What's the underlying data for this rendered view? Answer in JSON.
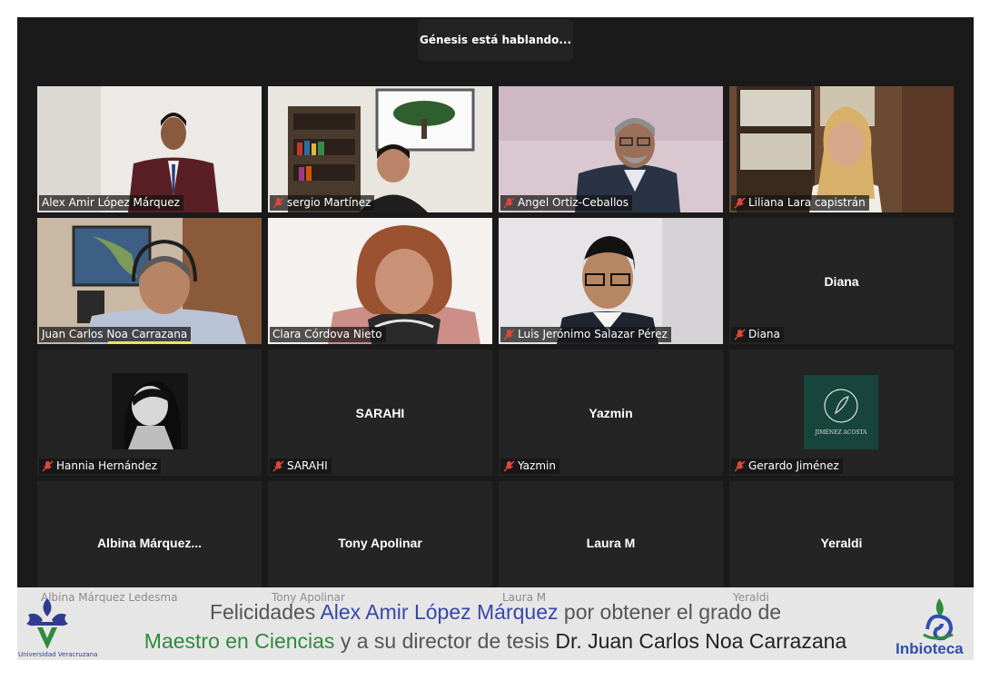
{
  "speaker_indicator": "Génesis está hablando...",
  "participants": [
    {
      "label": "Alex Amir López Márquez",
      "muted": false
    },
    {
      "label": "sergio Martínez",
      "muted": true
    },
    {
      "label": "Angel Ortiz-Ceballos",
      "muted": true
    },
    {
      "label": "Liliana Lara capistrán",
      "muted": true
    },
    {
      "label": "Juan Carlos Noa Carrazana",
      "muted": false
    },
    {
      "label": "Clara Córdova Nieto",
      "muted": false
    },
    {
      "label": "Luis Jerónimo Salazar Pérez",
      "muted": true
    },
    {
      "label": "Diana",
      "display": "Diana",
      "muted": true
    },
    {
      "label": "Hannia Hernández",
      "muted": true
    },
    {
      "label": "SARAHI",
      "display": "SARAHI",
      "muted": true
    },
    {
      "label": "Yazmin",
      "display": "Yazmin",
      "muted": true
    },
    {
      "label": "Gerardo Jiménez",
      "avatar_text": "JIMÉNEZ ACOSTA",
      "muted": true
    },
    {
      "label": "Albina Márquez Ledesma",
      "display": "Albina  Márquez...",
      "muted": true
    },
    {
      "label": "Tony Apolinar",
      "display": "Tony Apolinar",
      "muted": true
    },
    {
      "label": "Laura M",
      "display": "Laura M",
      "muted": true
    },
    {
      "label": "Yeraldi",
      "display": "Yeraldi",
      "muted": true
    }
  ],
  "banner": {
    "line1_pre": "Felicidades ",
    "line1_name": "Alex Amir López Márquez",
    "line1_post": " por obtener el grado de",
    "line2_degree": "Maestro en Ciencias",
    "line2_mid": " y a su director de tesis ",
    "line2_director": "Dr. Juan Carlos Noa Carrazana",
    "left_logo_text": "Universidad Veracruzana",
    "right_logo_text": "Inbioteca"
  },
  "colors": {
    "frame_bg": "#1a1a1a",
    "tile_bg": "#242424",
    "speaking_highlight": "#f3e347",
    "muted_red": "#e0463b",
    "banner_bg": "#e6e6e6",
    "name_blue": "#3848a8",
    "degree_green": "#2e8b3a"
  }
}
